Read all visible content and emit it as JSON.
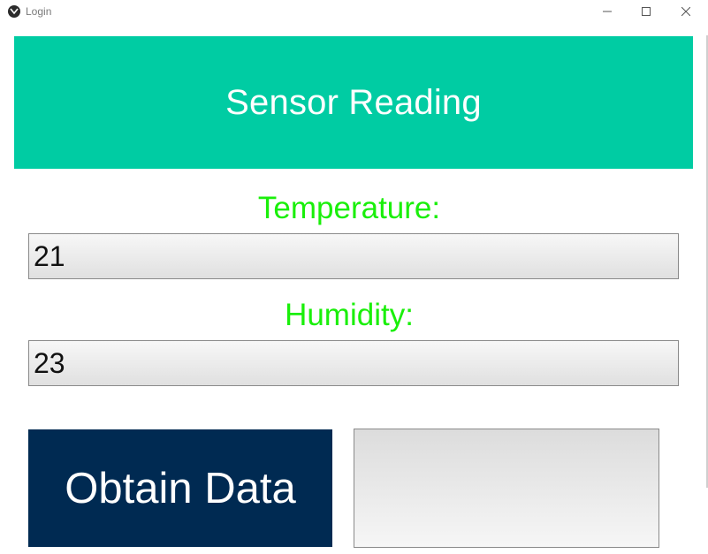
{
  "window": {
    "title": "Login",
    "controls": {
      "minimize_icon": "minimize-icon",
      "maximize_icon": "maximize-icon",
      "close_icon": "close-icon"
    }
  },
  "header": {
    "title": "Sensor Reading",
    "background": "#00cca3",
    "text_color": "#ffffff"
  },
  "temperature": {
    "label": "Temperature:",
    "value": "21"
  },
  "humidity": {
    "label": "Humidity:",
    "value": "23"
  },
  "label_color": "#1aef0a",
  "actions": {
    "obtain_label": "Obtain Data",
    "obtain_color": "#002a52"
  },
  "output": {
    "text": ""
  }
}
